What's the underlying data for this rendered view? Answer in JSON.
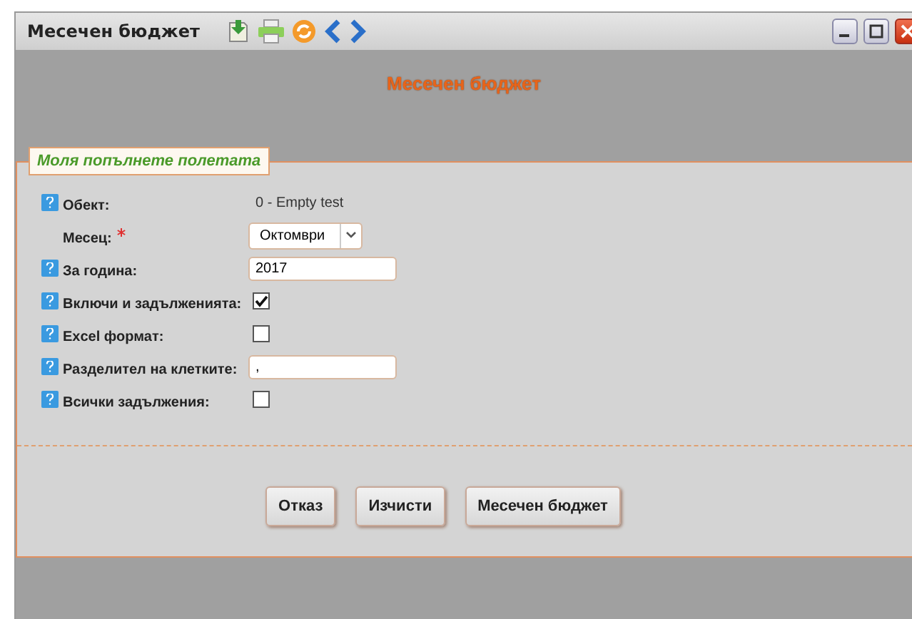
{
  "window": {
    "title": "Месечен бюджет"
  },
  "heading": "Месечен бюджет",
  "legend": "Моля попълнете полетата",
  "fields": [
    {
      "kind": "text",
      "label": "Обект:",
      "help": true,
      "required": false,
      "value": "0 - Empty test"
    },
    {
      "kind": "select",
      "label": "Месец:",
      "help": false,
      "required": true,
      "value": "Октомври"
    },
    {
      "kind": "input",
      "label": "За година:",
      "help": true,
      "required": false,
      "value": "2017"
    },
    {
      "kind": "checkbox",
      "label": "Включи и задълженията:",
      "help": true,
      "required": false,
      "checked": true
    },
    {
      "kind": "checkbox",
      "label": "Excel формат:",
      "help": true,
      "required": false,
      "checked": false
    },
    {
      "kind": "input",
      "label": "Разделител на клетките:",
      "help": true,
      "required": false,
      "value": ","
    },
    {
      "kind": "checkbox",
      "label": "Всички задължения:",
      "help": true,
      "required": false,
      "checked": false
    }
  ],
  "buttons": [
    "Отказ",
    "Изчисти",
    "Месечен бюджет"
  ]
}
